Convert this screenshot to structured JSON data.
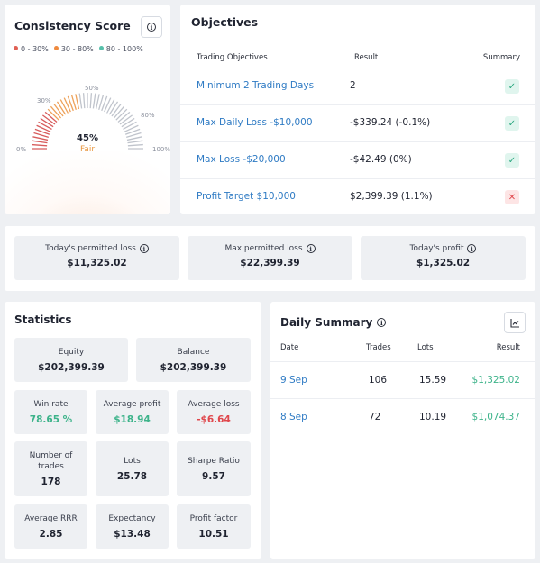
{
  "consistency": {
    "title": "Consistency Score",
    "legend": [
      {
        "label": "0 - 30%",
        "color": "#e06155"
      },
      {
        "label": "30 - 80%",
        "color": "#ef8a3f"
      },
      {
        "label": "80 - 100%",
        "color": "#56c0aa"
      }
    ],
    "ticks": [
      "0%",
      "30%",
      "50%",
      "80%",
      "100%"
    ],
    "value": "45%",
    "value_fraction": 0.45,
    "category": "Fair",
    "colors": {
      "low": "#d85c5c",
      "mid": "#eea25a",
      "rest": "#c0c4cc"
    }
  },
  "objectives": {
    "title": "Objectives",
    "headers": {
      "objective": "Trading Objectives",
      "result": "Result",
      "summary": "Summary"
    },
    "rows": [
      {
        "name": "Minimum 2 Trading Days",
        "result": "2",
        "status": "✓",
        "passed": true
      },
      {
        "name": "Max Daily Loss -$10,000",
        "result": "-$339.24 (-0.1%)",
        "status": "✓",
        "passed": true
      },
      {
        "name": "Max Loss -$20,000",
        "result": "-$42.49 (0%)",
        "status": "✓",
        "passed": true
      },
      {
        "name": "Profit Target $10,000",
        "result": "$2,399.39 (1.1%)",
        "status": "✕",
        "passed": false
      }
    ]
  },
  "permits": [
    {
      "label": "Today's permitted loss",
      "value": "$11,325.02"
    },
    {
      "label": "Max permitted loss",
      "value": "$22,399.39"
    },
    {
      "label": "Today's profit",
      "value": "$1,325.02"
    }
  ],
  "statistics": {
    "title": "Statistics",
    "equity": {
      "label": "Equity",
      "value": "$202,399.39"
    },
    "balance": {
      "label": "Balance",
      "value": "$202,399.39"
    },
    "win_rate": {
      "label": "Win rate",
      "value": "78.65 %"
    },
    "average_profit": {
      "label": "Average profit",
      "value": "$18.94"
    },
    "average_loss": {
      "label": "Average loss",
      "value": "-$6.64"
    },
    "number_of_trades": {
      "label": "Number of trades",
      "value": "178"
    },
    "lots": {
      "label": "Lots",
      "value": "25.78"
    },
    "sharpe_ratio": {
      "label": "Sharpe Ratio",
      "value": "9.57"
    },
    "average_rrr": {
      "label": "Average RRR",
      "value": "2.85"
    },
    "expectancy": {
      "label": "Expectancy",
      "value": "$13.48"
    },
    "profit_factor": {
      "label": "Profit factor",
      "value": "10.51"
    }
  },
  "daily_summary": {
    "title": "Daily Summary",
    "headers": {
      "date": "Date",
      "trades": "Trades",
      "lots": "Lots",
      "result": "Result"
    },
    "rows": [
      {
        "date": "9 Sep",
        "trades": "106",
        "lots": "15.59",
        "result": "$1,325.02"
      },
      {
        "date": "8 Sep",
        "trades": "72",
        "lots": "10.19",
        "result": "$1,074.37"
      }
    ]
  },
  "icons": {
    "info": "info-icon",
    "chart": "line-chart-icon",
    "check": "check-icon",
    "cross": "cross-icon"
  }
}
